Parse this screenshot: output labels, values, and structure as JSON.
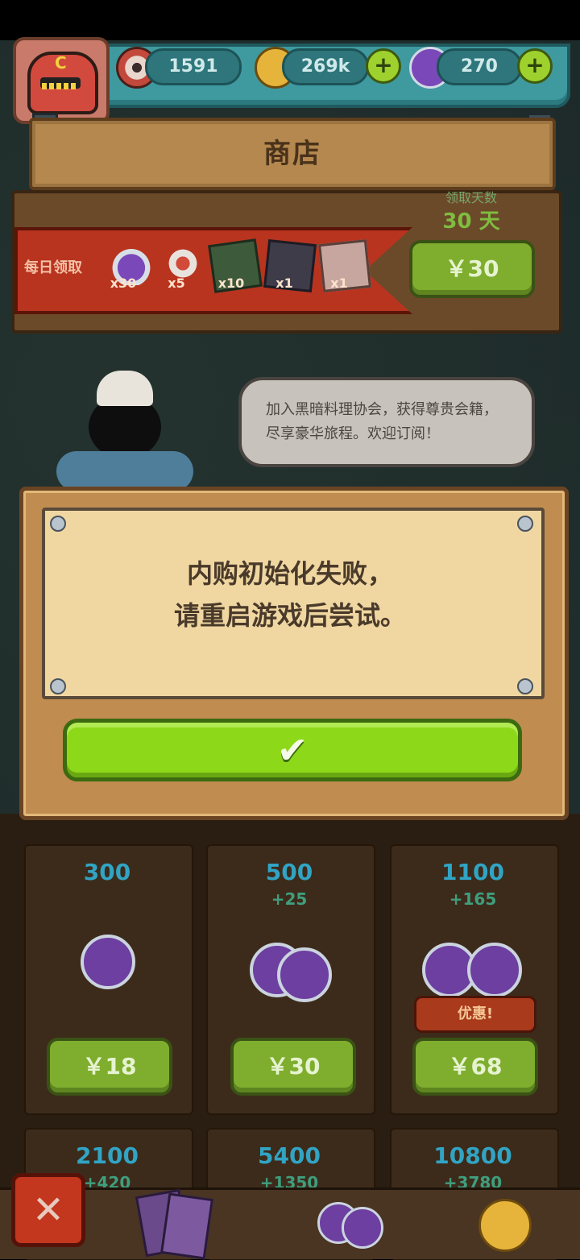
{
  "header": {
    "currency": [
      {
        "name": "eyeball",
        "value": "1591"
      },
      {
        "name": "coins",
        "value": "269k"
      },
      {
        "name": "potion",
        "value": "270"
      }
    ]
  },
  "shop": {
    "title": "商店"
  },
  "daily": {
    "label": "每日领取",
    "days_label": "领取天数",
    "days_value": "30 天",
    "items": [
      {
        "icon": "potion-icon",
        "count": "x30"
      },
      {
        "icon": "scroll-icon",
        "count": "x5"
      },
      {
        "icon": "card-icon",
        "count": "x10"
      },
      {
        "icon": "card-icon",
        "count": "x1"
      },
      {
        "icon": "card-icon",
        "count": "x1"
      }
    ],
    "price": "￥30"
  },
  "bubble": {
    "text": "加入黑暗料理协会，获得尊贵会籍，尽享豪华旅程。欢迎订阅！"
  },
  "modal": {
    "line1": "内购初始化失败，",
    "line2": "请重启游戏后尝试。",
    "confirm": "✔"
  },
  "packs": [
    {
      "amount": "300",
      "bonus": "",
      "price": "￥18"
    },
    {
      "amount": "500",
      "bonus": "+25",
      "price": "￥30"
    },
    {
      "amount": "1100",
      "bonus": "+165",
      "price": "￥68",
      "badge": "优惠!"
    },
    {
      "amount": "2100",
      "bonus": "+420"
    },
    {
      "amount": "5400",
      "bonus": "+1350"
    },
    {
      "amount": "10800",
      "bonus": "+3780"
    }
  ],
  "close_label": "✕",
  "colors": {
    "accent_green": "#8ed81a",
    "wood": "#c08c50",
    "parchment": "#f0d7a2"
  }
}
